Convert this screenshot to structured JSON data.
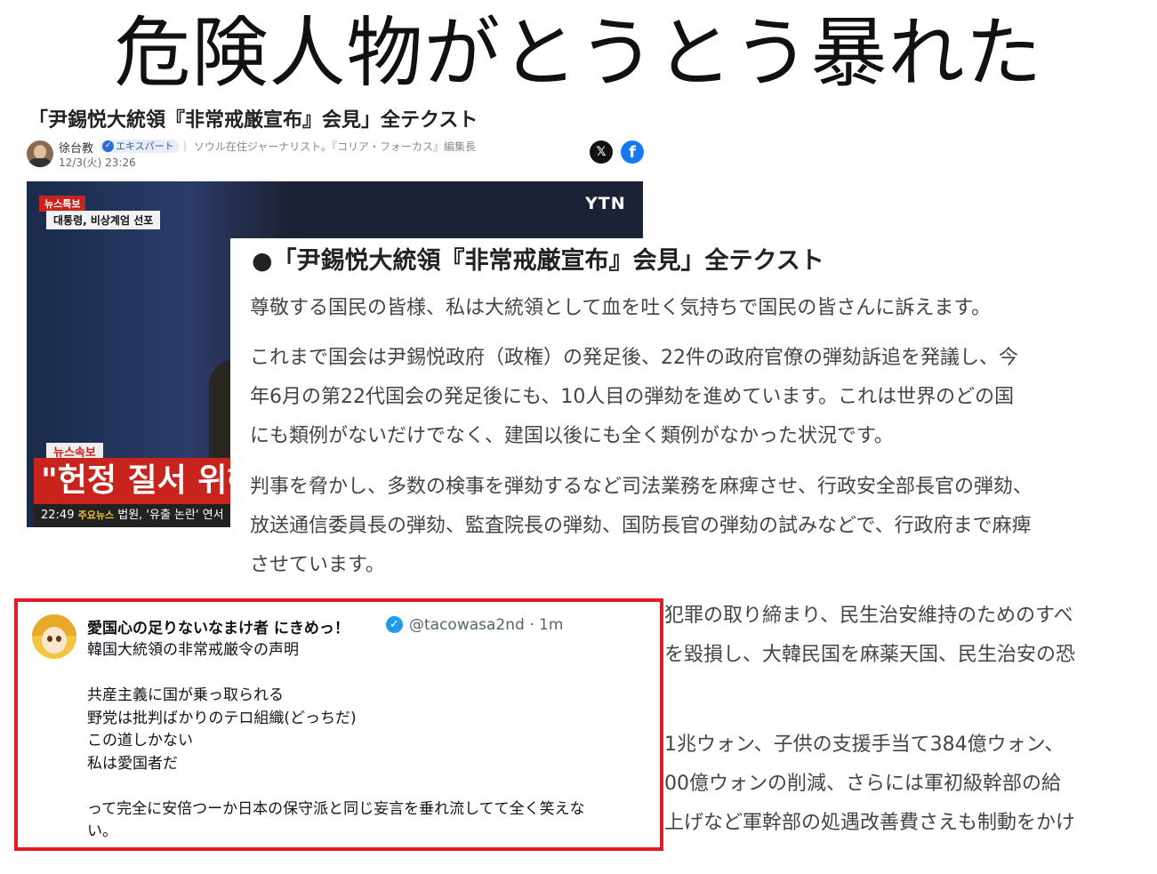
{
  "headline": "危険人物がとうとう暴れた",
  "article": {
    "title": "「尹錫悦大統領『非常戒厳宣布』会見」全テクスト",
    "author": "徐台教",
    "badge": "エキスパート",
    "bio": "｜ ソウル在住ジャーナリスト。『コリア・フォーカス』編集長",
    "date": "12/3(火) 23:26",
    "share_x": "𝕏",
    "share_fb": "f"
  },
  "video": {
    "tag_breaking": "뉴스특보",
    "subtitle": "대통령, 비상계엄 선포",
    "logo": "YTN",
    "tag_flash": "뉴스속보",
    "caption": "\"헌정 질서 위해 비",
    "ticker_time": "22:49",
    "ticker_label": "주요뉴스",
    "ticker_text": "법원, '유출 논란' 연서"
  },
  "panel": {
    "title": "●「尹錫悦大統領『非常戒厳宣布』会見」全テクスト",
    "p1": "尊敬する国民の皆様、私は大統領として血を吐く気持ちで国民の皆さんに訴えます。",
    "p2": [
      "これまで国会は尹錫悦政府（政権）の発足後、22件の政府官僚の弾劾訴追を発議し、今",
      "年6月の第22代国会の発足後にも、10人目の弾劾を進めています。これは世界のどの国",
      "にも類例がないだけでなく、建国以後にも全く類例がなかった状況です。"
    ],
    "p3": [
      "判事を脅かし、多数の検事を弾劾するなど司法業務を麻痺させ、行政安全部長官の弾劾、",
      "放送通信委員長の弾劾、監査院長の弾劾、国防長官の弾劾の試みなどで、行政府まで麻痺",
      "させています。"
    ],
    "p4": [
      "犯罪の取り締まり、民生治安維持のためのすべ",
      "を毀損し、大韓民国を麻薬天国、民生治安の恐"
    ],
    "p5": [
      "1兆ウォン、子供の支援手当て384億ウォン、",
      "00億ウォンの削減、さらには軍初級幹部の給",
      "上げなど軍幹部の処遇改善費さえも制動をかけ"
    ]
  },
  "tweet": {
    "name": "愛国心の足りないなまけ者 にきめっ！",
    "verified": "✓",
    "handle": "@tacowasa2nd · 1m",
    "lines": [
      "韓国大統領の非常戒厳令の声明",
      "",
      "共産主義に国が乗っ取られる",
      "野党は批判ばかりのテロ組織(どっちだ)",
      "この道しかない",
      "私は愛国者だ",
      "",
      "って完全に安倍つーか日本の保守派と同じ妄言を垂れ流してて全く笑えな",
      "い。"
    ]
  },
  "colors": {
    "highlight_border": "#e01b24",
    "verified": "#1d9bf0",
    "news_red": "#c8231d"
  }
}
